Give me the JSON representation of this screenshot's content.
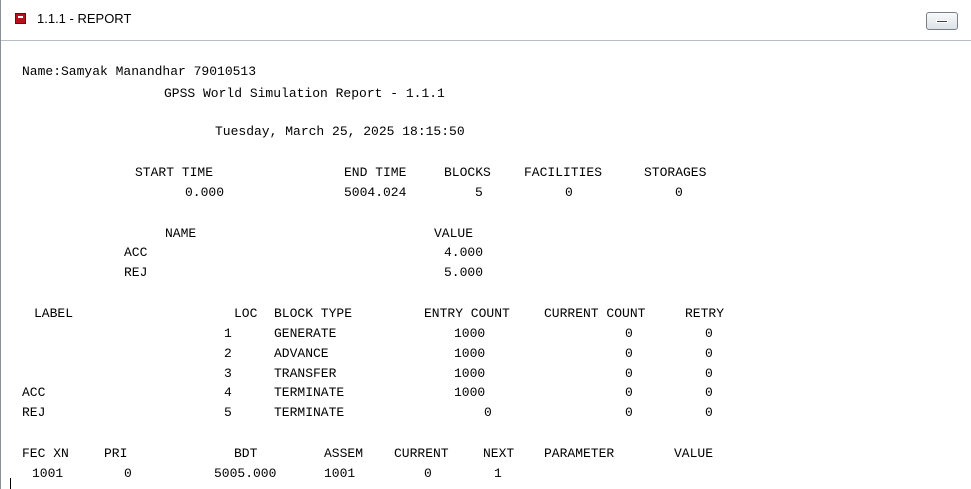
{
  "window": {
    "title": "1.1.1 - REPORT",
    "minimize_label": "minimize"
  },
  "report": {
    "name_line": "Name:Samyak Manandhar 79010513",
    "report_title": "GPSS World Simulation Report - 1.1.1",
    "timestamp": "Tuesday, March 25, 2025 18:15:50",
    "summary_headers": {
      "start_time": "START TIME",
      "end_time": "END TIME",
      "blocks": "BLOCKS",
      "facilities": "FACILITIES",
      "storages": "STORAGES"
    },
    "summary_values": {
      "start_time": "0.000",
      "end_time": "5004.024",
      "blocks": "5",
      "facilities": "0",
      "storages": "0"
    },
    "names_headers": {
      "name": "NAME",
      "value": "VALUE"
    },
    "names": [
      {
        "name": "ACC",
        "value": "4.000"
      },
      {
        "name": "REJ",
        "value": "5.000"
      }
    ],
    "block_headers": {
      "label": "LABEL",
      "loc": "LOC",
      "block_type": "BLOCK TYPE",
      "entry_count": "ENTRY COUNT",
      "current_count": "CURRENT COUNT",
      "retry": "RETRY"
    },
    "blocks": [
      {
        "label": "",
        "loc": "1",
        "block_type": "GENERATE",
        "entry_count": "1000",
        "current_count": "0",
        "retry": "0"
      },
      {
        "label": "",
        "loc": "2",
        "block_type": "ADVANCE",
        "entry_count": "1000",
        "current_count": "0",
        "retry": "0"
      },
      {
        "label": "",
        "loc": "3",
        "block_type": "TRANSFER",
        "entry_count": "1000",
        "current_count": "0",
        "retry": "0"
      },
      {
        "label": "ACC",
        "loc": "4",
        "block_type": "TERMINATE",
        "entry_count": "1000",
        "current_count": "0",
        "retry": "0"
      },
      {
        "label": "REJ",
        "loc": "5",
        "block_type": "TERMINATE",
        "entry_count": "0",
        "current_count": "0",
        "retry": "0"
      }
    ],
    "fec_headers": {
      "fec_xn": "FEC XN",
      "pri": "PRI",
      "bdt": "BDT",
      "assem": "ASSEM",
      "current": "CURRENT",
      "next": "NEXT",
      "parameter": "PARAMETER",
      "value": "VALUE"
    },
    "fec": [
      {
        "xn": "1001",
        "pri": "0",
        "bdt": "5005.000",
        "assem": "1001",
        "current": "0",
        "next": "1",
        "parameter": "",
        "value": ""
      }
    ]
  }
}
